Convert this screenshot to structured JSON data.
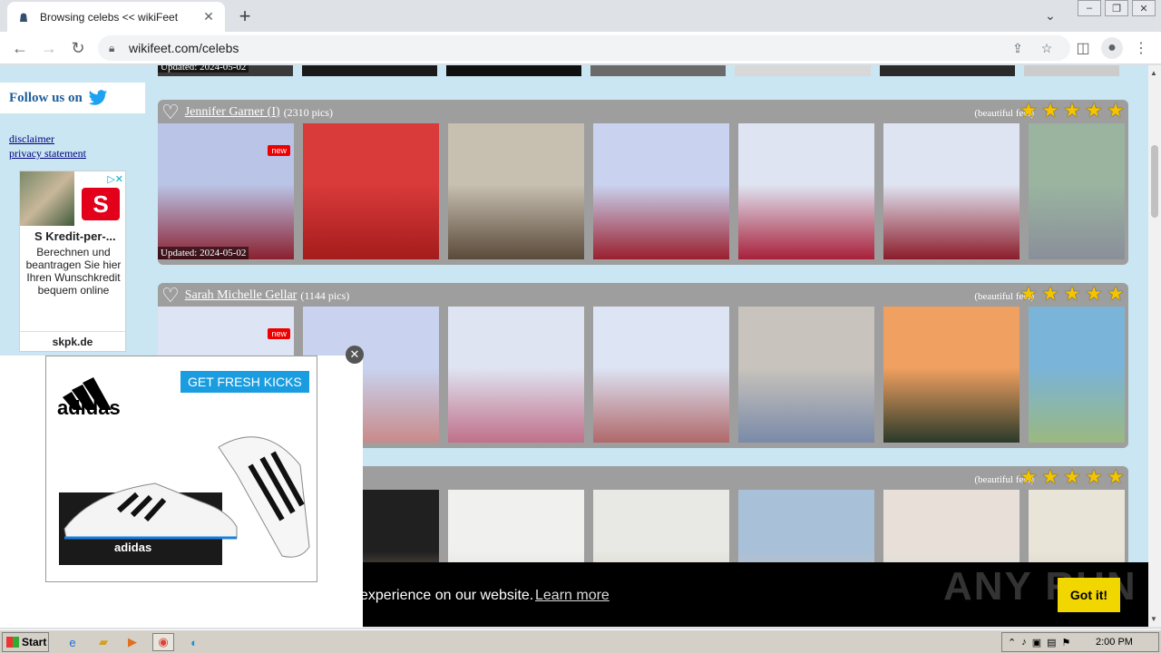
{
  "browser": {
    "tab_title": "Browsing celebs << wikiFeet",
    "tab_close": "✕",
    "new_tab": "+",
    "url": "wikifeet.com/celebs"
  },
  "sidebar": {
    "follow_label": "Follow us on",
    "links": [
      "disclaimer",
      "privacy statement"
    ]
  },
  "side_ad": {
    "title": "S Kredit-per-...",
    "body": "Berechnen und beantragen Sie hier Ihren Wunschkredit bequem online",
    "source": "skpk.de",
    "logo_text": "S"
  },
  "top_strip": {
    "updated": "Updated: 2024-05-02"
  },
  "celebs": [
    {
      "name": "Jennifer Garner (I)",
      "count": "(2310 pics)",
      "rating": "(beautiful feet)",
      "stars": 5,
      "new_label": "new",
      "updated": "Updated: 2024-05-02",
      "pics": [
        {
          "c1": "#b9c4e6",
          "c2": "#8b2030"
        },
        {
          "c1": "#d93a3a",
          "c2": "#a51c1c"
        },
        {
          "c1": "#c7bfb0",
          "c2": "#5a4a3a"
        },
        {
          "c1": "#c9d3f0",
          "c2": "#9a1f2e"
        },
        {
          "c1": "#dfe4f2",
          "c2": "#a8203a"
        },
        {
          "c1": "#dfe4f2",
          "c2": "#8c1c2a"
        },
        {
          "c1": "#9ab4a0",
          "c2": "#8a8f9a"
        }
      ]
    },
    {
      "name": "Sarah Michelle Gellar",
      "count": "(1144 pics)",
      "rating": "(beautiful feet)",
      "stars": 5,
      "new_label": "new",
      "pics": [
        {
          "c1": "#dde4f4",
          "c2": "#e0c9a8"
        },
        {
          "c1": "#c9d3f0",
          "c2": "#c88a8a"
        },
        {
          "c1": "#dfe4f2",
          "c2": "#c0708a"
        },
        {
          "c1": "#dde4f4",
          "c2": "#b0686a"
        },
        {
          "c1": "#c8c3bc",
          "c2": "#7a8aa8"
        },
        {
          "c1": "#f0a060",
          "c2": "#2a3a2a"
        },
        {
          "c1": "#7ab4d8",
          "c2": "#9ab880"
        }
      ]
    },
    {
      "name": "",
      "count": "",
      "rating": "(beautiful feet)",
      "stars": 5,
      "pics": [
        {
          "c1": "#eeeeee",
          "c2": "#dddddd"
        },
        {
          "c1": "#202020",
          "c2": "#d4b090"
        },
        {
          "c1": "#f0f0ee",
          "c2": "#c8c8c0"
        },
        {
          "c1": "#e8e8e4",
          "c2": "#c8b8a0"
        },
        {
          "c1": "#a8c0d8",
          "c2": "#e8c0a0"
        },
        {
          "c1": "#e8e0d8",
          "c2": "#c0d4e0"
        },
        {
          "c1": "#e8e4d8",
          "c2": "#c8c0b0"
        }
      ]
    }
  ],
  "overlay_ad": {
    "brand": "adidas",
    "cta": "GET FRESH KICKS",
    "box_brand": "adidas",
    "close": "✕"
  },
  "cookie": {
    "message": "experience on our website.",
    "learn_more": "Learn more",
    "button": "Got it!"
  },
  "watermark": "ANY RUN",
  "taskbar": {
    "start": "Start",
    "time": "2:00 PM"
  },
  "colors": {
    "page_bg": "#c9e6f2",
    "card_bg": "#9e9e9e",
    "star": "#f5c400",
    "cookie_button": "#f1d600"
  }
}
